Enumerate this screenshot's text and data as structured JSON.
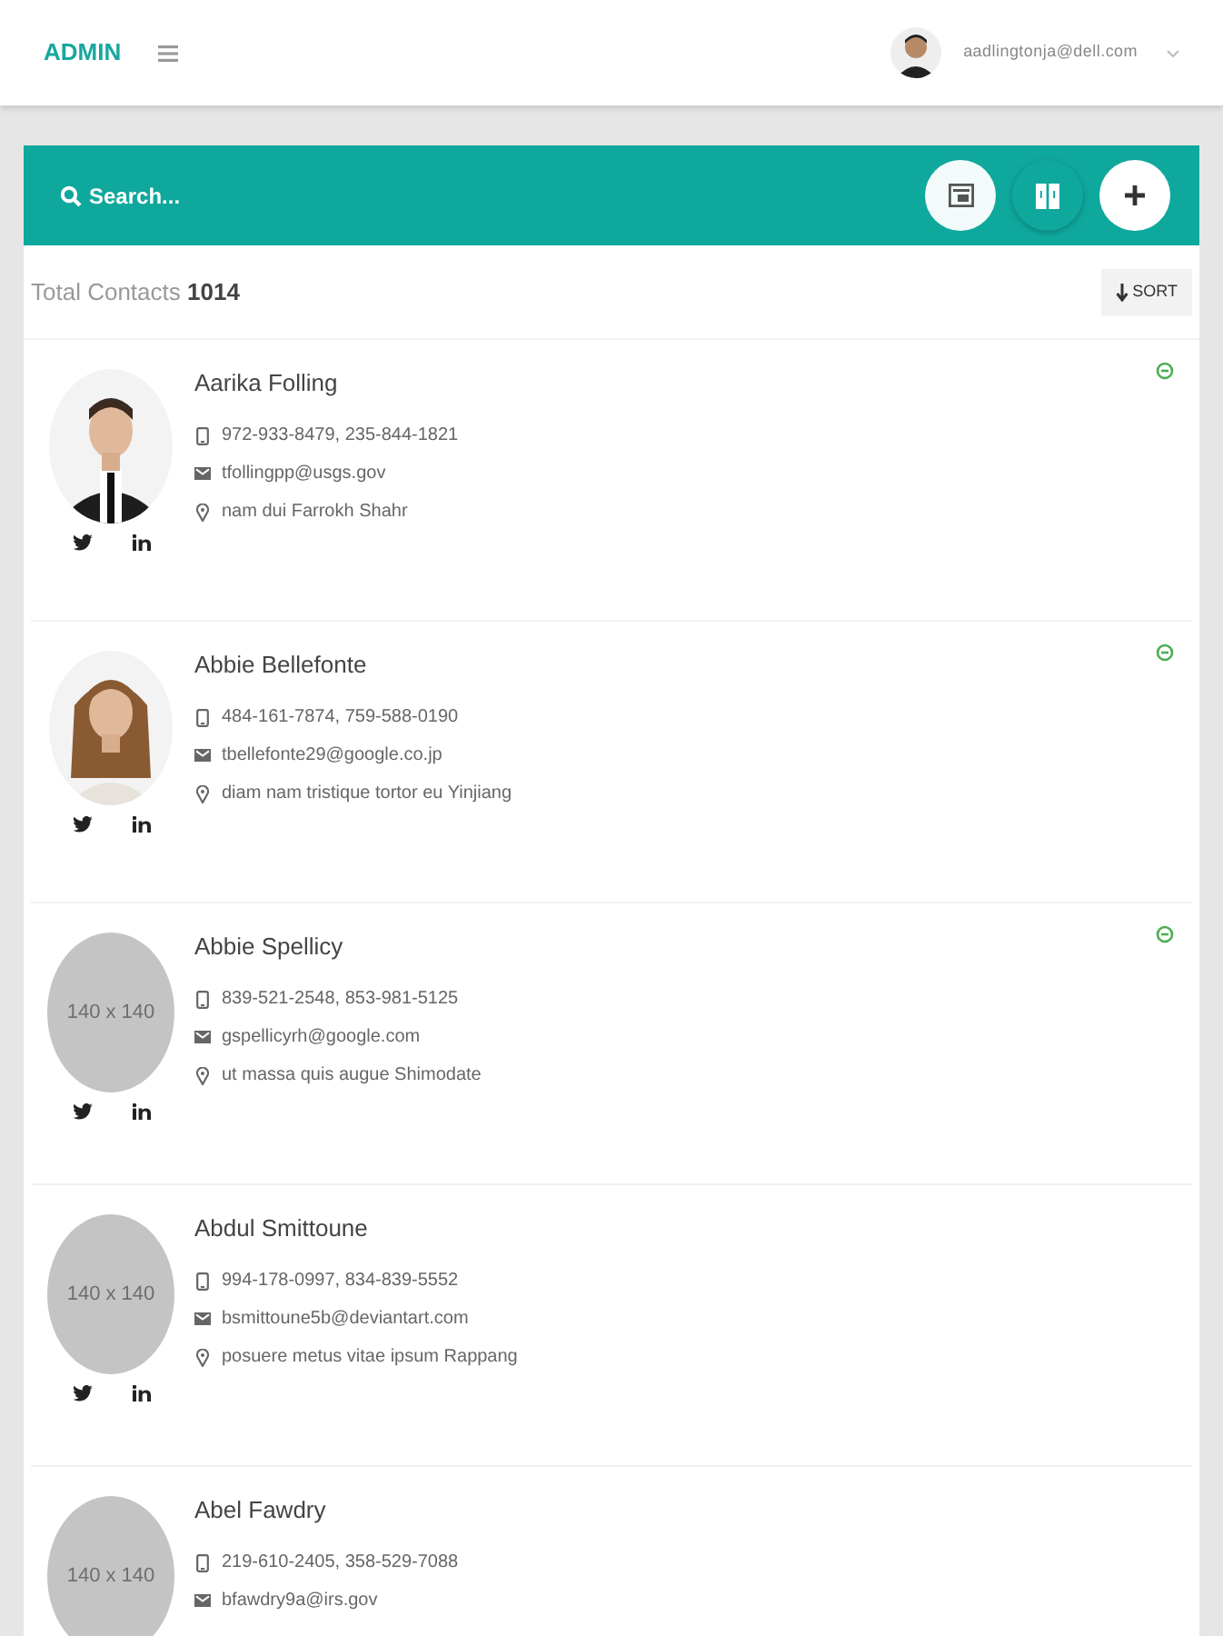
{
  "header": {
    "brand": "ADMIN",
    "user_email": "aadlingtonja@dell.com"
  },
  "toolbar": {
    "search_placeholder": "Search..."
  },
  "summary": {
    "label": "Total Contacts",
    "count": "1014",
    "sort_button": "SORT"
  },
  "contacts": [
    {
      "name": "Aarika Folling",
      "phones": "972-933-8479, 235-844-1821",
      "email": "tfollingpp@usgs.gov",
      "address": "nam dui Farrokh Shahr",
      "active": true,
      "social": true
    },
    {
      "name": "Abbie Bellefonte",
      "phones": "484-161-7874, 759-588-0190",
      "email": "tbellefonte29@google.co.jp",
      "address": "diam nam tristique tortor eu Yinjiang",
      "active": true,
      "social": true
    },
    {
      "name": "Abbie Spellicy",
      "phones": "839-521-2548, 853-981-5125",
      "email": "gspellicyrh@google.com",
      "address": "ut massa quis augue Shimodate",
      "avatar": {
        "kind": "placeholder",
        "label": "140 x 140"
      },
      "active": true,
      "social": true
    },
    {
      "name": "Abdul Smittoune",
      "phones": "994-178-0997, 834-839-5552",
      "email": "bsmittoune5b@deviantart.com",
      "address": "posuere metus vitae ipsum Rappang",
      "avatar": {
        "kind": "placeholder",
        "label": "140 x 140"
      },
      "active": false,
      "social": true
    },
    {
      "name": "Abel Fawdry",
      "phones": "219-610-2405, 358-529-7088",
      "email": "bfawdry9a@irs.gov",
      "avatar": {
        "kind": "placeholder",
        "label": "140 x 140"
      },
      "active": false,
      "social": false
    }
  ]
}
